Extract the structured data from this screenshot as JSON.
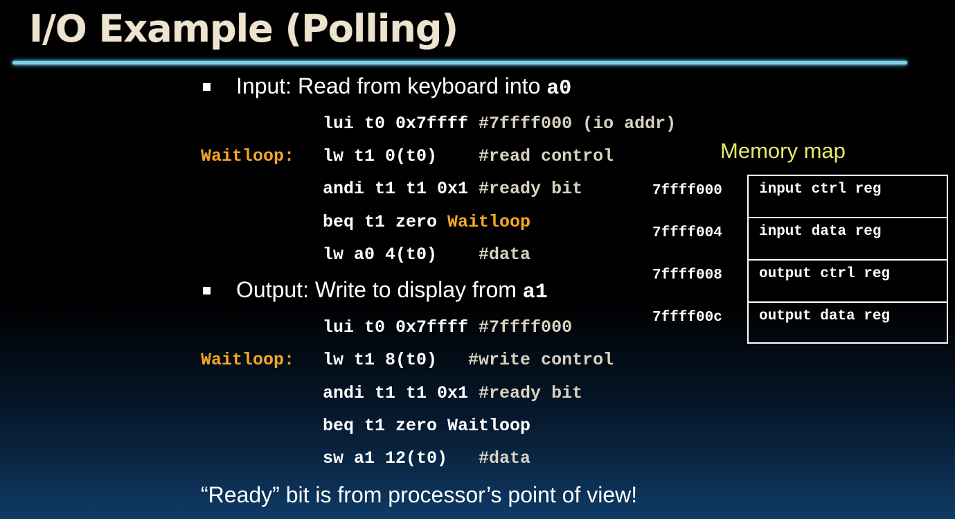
{
  "slide": {
    "title": "I/O Example (Polling)",
    "input_section": {
      "bullet_text": "Input: Read from keyboard into ",
      "bullet_reg": "a0",
      "lines": [
        {
          "label": "",
          "code": "lui t0 0x7ffff ",
          "comment": "#7ffff000 (io addr)"
        },
        {
          "label": "Waitloop:",
          "code": "lw t1 0(t0)    ",
          "comment": "#read control"
        },
        {
          "label": "",
          "code": "andi t1 t1 0x1 ",
          "comment": "#ready bit"
        },
        {
          "label": "",
          "code": "beq t1 zero ",
          "comment": "",
          "target": "Waitloop"
        },
        {
          "label": "",
          "code": "lw a0 4(t0)    ",
          "comment": "#data"
        }
      ]
    },
    "output_section": {
      "bullet_text": "Output: Write to display from ",
      "bullet_reg": "a1",
      "lines": [
        {
          "label": "",
          "code": "lui t0 0x7ffff ",
          "comment": "#7ffff000"
        },
        {
          "label": "Waitloop:",
          "code": "lw t1 8(t0)   ",
          "comment": "#write control"
        },
        {
          "label": "",
          "code": "andi t1 t1 0x1 ",
          "comment": "#ready bit"
        },
        {
          "label": "",
          "code": "beq t1 zero Waitloop",
          "comment": ""
        },
        {
          "label": "",
          "code": "sw a1 12(t0)   ",
          "comment": "#data"
        }
      ]
    },
    "memory_map": {
      "title": "Memory map",
      "rows": [
        {
          "address": "7ffff000",
          "name": "input ctrl reg"
        },
        {
          "address": "7ffff004",
          "name": "input data reg"
        },
        {
          "address": "7ffff008",
          "name": "output ctrl reg"
        },
        {
          "address": "7ffff00c",
          "name": "output data reg"
        }
      ]
    },
    "footnote": "“Ready” bit is from processor’s point of view!"
  }
}
